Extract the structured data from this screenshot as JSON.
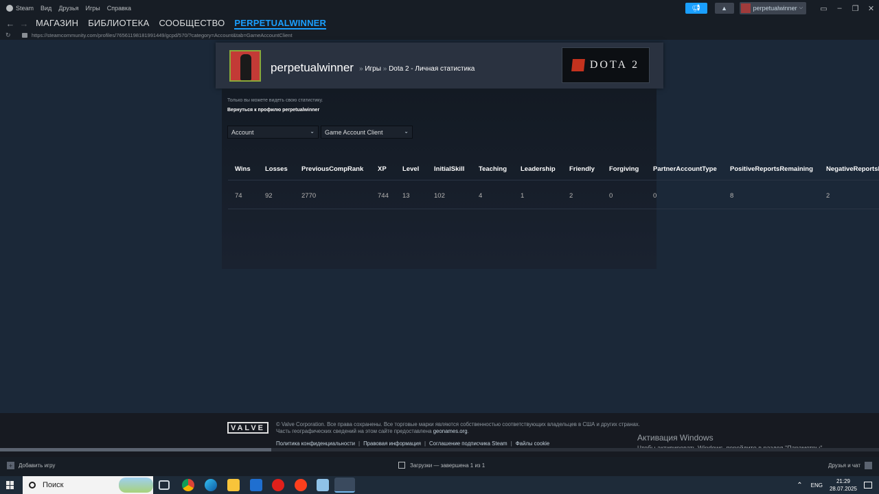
{
  "titlebar": {
    "menu": [
      "Steam",
      "Вид",
      "Друзья",
      "Игры",
      "Справка"
    ],
    "username": "perpetualwinner"
  },
  "nav": {
    "tabs": [
      "МАГАЗИН",
      "БИБЛИОТЕКА",
      "СООБЩЕСТВО",
      "PERPETUALWINNER"
    ],
    "active_tab": "PERPETUALWINNER"
  },
  "url": "https://steamcommunity.com/profiles/76561198181991449/gcpd/570/?category=Account&tab=GameAccountClient",
  "profile": {
    "name": "perpetualwinner",
    "crumb_sep": "»",
    "crumb_games": "Игры",
    "crumb_stats": "Dota 2 - Личная статистика",
    "game_logo_text": "DOTA 2"
  },
  "stats": {
    "note": "Только вы можете видеть свою статистику.",
    "back_link": "Вернуться к профилю perpetualwinner",
    "category_select": "Account",
    "tab_select": "Game Account Client",
    "columns": [
      "Wins",
      "Losses",
      "PreviousCompRank",
      "XP",
      "Level",
      "InitialSkill",
      "Teaching",
      "Leadership",
      "Friendly",
      "Forgiving",
      "PartnerAccountType",
      "PositiveReportsRemaining",
      "NegativeReportsR"
    ],
    "values": [
      "74",
      "92",
      "2770",
      "744",
      "13",
      "102",
      "4",
      "1",
      "2",
      "0",
      "0",
      "8",
      "2"
    ]
  },
  "footer": {
    "valve": "VALVE",
    "legal_line1": "© Valve Corporation. Все права сохранены. Все торговые марки являются собственностью соответствующих владельцев в США и других странах.",
    "legal_line2": "Часть географических сведений на этом сайте предоставлена",
    "legal_geonames": "geonames.org",
    "legal_dot": ".",
    "links": [
      "Политика конфиденциальности",
      "Правовая информация",
      "Соглашение подписчика Steam",
      "Файлы cookie"
    ],
    "link_sep": "|",
    "activate_title": "Активация Windows",
    "activate_text": "Чтобы активировать Windows, перейдите в раздел \"Параметры\"."
  },
  "statusbar": {
    "add_game": "Добавить игру",
    "downloads": "Загрузки — завершена 1 из 1",
    "friends": "Друзья и чат"
  },
  "taskbar": {
    "search": "Поиск",
    "lang": "ENG",
    "time": "21:29",
    "date": "28.07.2025"
  },
  "colors": {
    "accent": "#1a9fff",
    "background": "#1b2838",
    "chrome": "#171d25"
  }
}
